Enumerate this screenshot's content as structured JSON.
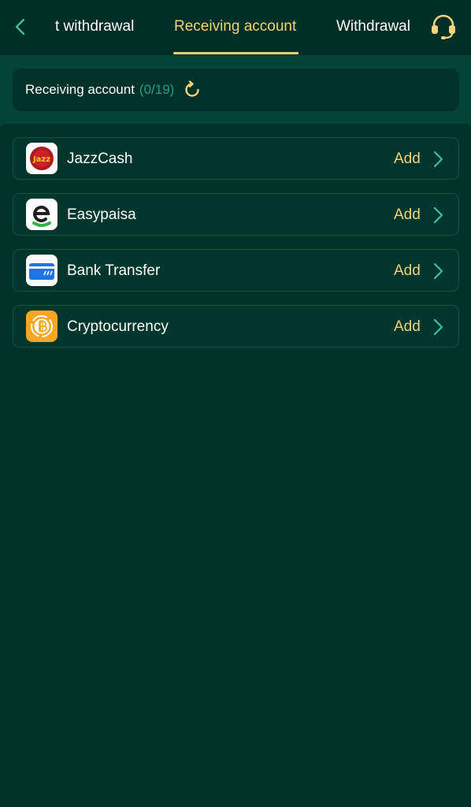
{
  "header": {
    "tabs": [
      {
        "label": "t withdrawal",
        "active": false
      },
      {
        "label": "Receiving account",
        "active": true
      },
      {
        "label": "Withdrawal",
        "active": false
      }
    ],
    "back_icon": "chevron-left-icon",
    "support_icon": "headset-icon"
  },
  "summary": {
    "label": "Receiving account",
    "count": "(0/19)",
    "refresh_icon": "refresh-icon"
  },
  "methods": [
    {
      "name": "JazzCash",
      "action": "Add",
      "icon": "jazzcash-logo"
    },
    {
      "name": "Easypaisa",
      "action": "Add",
      "icon": "easypaisa-logo"
    },
    {
      "name": "Bank Transfer",
      "action": "Add",
      "icon": "bank-card-icon"
    },
    {
      "name": "Cryptocurrency",
      "action": "Add",
      "icon": "bitcoin-icon"
    }
  ],
  "colors": {
    "background": "#013329",
    "accent": "#f2d27a",
    "count": "#1f9e7e",
    "back_arrow": "#3fbf9f"
  },
  "logos": {
    "jazzcash_text": "Jazz"
  }
}
